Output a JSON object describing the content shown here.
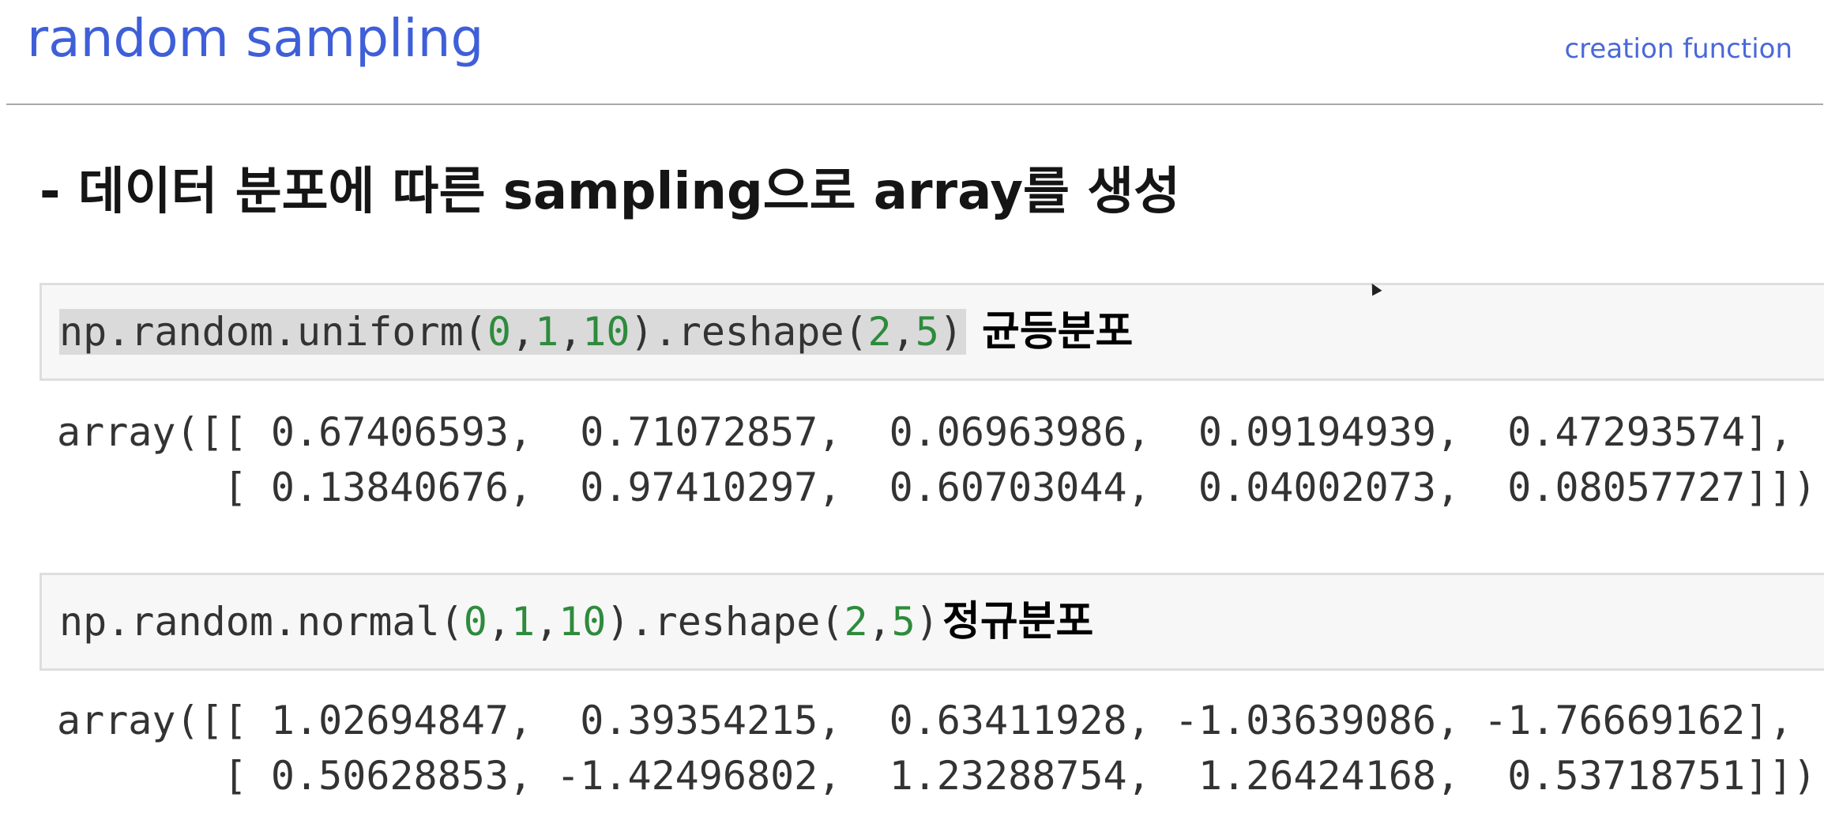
{
  "header": {
    "title": "random sampling",
    "category": "creation function"
  },
  "subtitle": "- 데이터 분포에 따른 sampling으로 array를 생성",
  "cells": [
    {
      "code": {
        "prefix": "np.random.uniform(",
        "arg1": "0",
        "arg2": "1",
        "arg3": "10",
        "middle": ").reshape(",
        "shape1": "2",
        "shape2": "5",
        "suffix": ")"
      },
      "note": "균등분포",
      "output": [
        "array([[ 0.67406593,  0.71072857,  0.06963986,  0.09194939,  0.47293574],",
        "       [ 0.13840676,  0.97410297,  0.60703044,  0.04002073,  0.08057727]])"
      ]
    },
    {
      "code": {
        "prefix": "np.random.normal(",
        "arg1": "0",
        "arg2": "1",
        "arg3": "10",
        "middle": ").reshape(",
        "shape1": "2",
        "shape2": "5",
        "suffix": ")"
      },
      "note": "정규분포",
      "output": [
        "array([[ 1.02694847,  0.39354215,  0.63411928, -1.03639086, -1.76669162],",
        "       [ 0.50628853, -1.42496802,  1.23288754,  1.26424168,  0.53718751]])"
      ]
    }
  ]
}
